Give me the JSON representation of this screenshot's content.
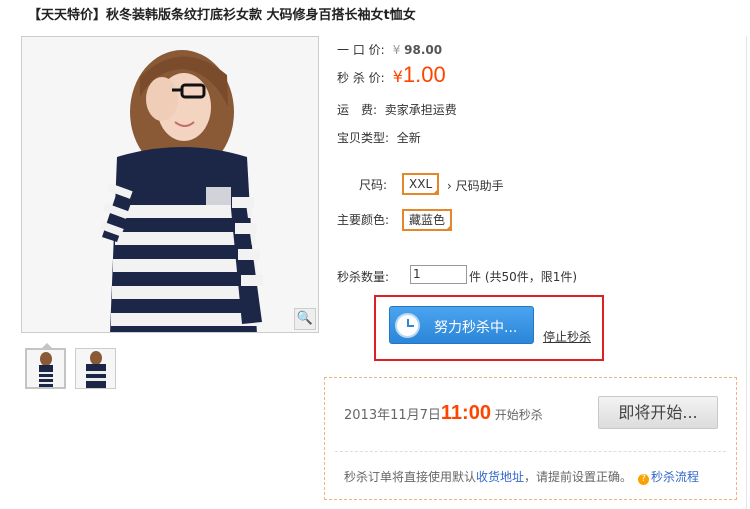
{
  "title": "【天天特价】秋冬装韩版条纹打底衫女款 大码修身百搭长袖女t恤女",
  "price": {
    "original_label": "一 口 价:",
    "original_currency": "¥",
    "original_value": "98.00",
    "sale_label": "秒 杀 价:",
    "sale_currency": "¥",
    "sale_value": "1.00"
  },
  "shipping": {
    "label": "运　费:",
    "value": "卖家承担运费"
  },
  "condition": {
    "label": "宝贝类型:",
    "value": "全新"
  },
  "size": {
    "label": "尺码:",
    "selected": "XXL",
    "helper": "› 尺码助手"
  },
  "color": {
    "label": "主要颜色:",
    "selected": "藏蓝色"
  },
  "quantity": {
    "label": "秒杀数量:",
    "value": "1",
    "note": "件 (共50件，限1件)"
  },
  "seckill": {
    "button": "努力秒杀中...",
    "stop": "停止秒杀"
  },
  "panel": {
    "date": "2013年11月7日",
    "time": "11:00",
    "start": " 开始秒杀",
    "button": "即将开始...",
    "note_before": "秒杀订单将直接使用默认",
    "note_link": "收货地址",
    "note_after": "，请提前设置正确。",
    "help_link": "秒杀流程",
    "help_icon_text": "?"
  },
  "zoom_icon_text": "🔍",
  "colors": {
    "accent": "#ff4400",
    "border_highlight": "#e02020",
    "chip": "#e3872a",
    "button_blue": "#2c86d9"
  }
}
